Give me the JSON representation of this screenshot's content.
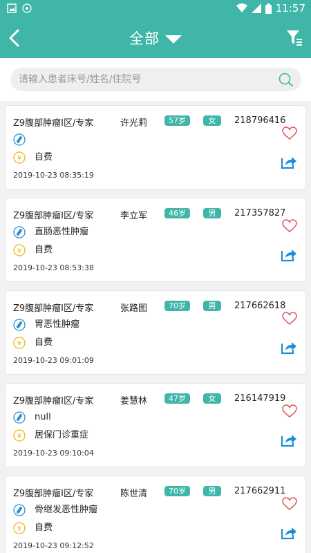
{
  "status_bar": {
    "time": "11:57"
  },
  "header": {
    "title": "全部"
  },
  "search": {
    "placeholder": "请输入患者床号/姓名/住院号"
  },
  "patients": [
    {
      "dept": "Z9腹部肿瘤I区/专家",
      "name": "许光莉",
      "age": "57岁",
      "sex": "女",
      "id": "218796416",
      "diagnosis": "",
      "payment": "自费",
      "time": "2019-10-23 08:35:19"
    },
    {
      "dept": "Z9腹部肿瘤I区/专家",
      "name": "李立军",
      "age": "46岁",
      "sex": "男",
      "id": "217357827",
      "diagnosis": "直肠恶性肿瘤",
      "payment": "自费",
      "time": "2019-10-23 08:53:38"
    },
    {
      "dept": "Z9腹部肿瘤I区/专家",
      "name": "张路图",
      "age": "70岁",
      "sex": "男",
      "id": "217662618",
      "diagnosis": "胃恶性肿瘤",
      "payment": "自费",
      "time": "2019-10-23 09:01:09"
    },
    {
      "dept": "Z9腹部肿瘤I区/专家",
      "name": "姜慧林",
      "age": "47岁",
      "sex": "女",
      "id": "216147919",
      "diagnosis": "null",
      "payment": "居保门诊重症",
      "time": "2019-10-23 09:10:04"
    },
    {
      "dept": "Z9腹部肿瘤I区/专家",
      "name": "陈世清",
      "age": "70岁",
      "sex": "男",
      "id": "217662911",
      "diagnosis": "骨继发恶性肿瘤",
      "payment": "自费",
      "time": "2019-10-23 09:12:52"
    }
  ],
  "colors": {
    "accent": "#3fb6a8",
    "heart": "#e0525a",
    "diagnosis_icon": "#2c8fd4",
    "payment_icon": "#f2b21b",
    "share": "#1a8ed8"
  },
  "icons": {
    "back": "back-icon",
    "filter": "filter-icon",
    "search": "search-icon",
    "heart": "heart-icon",
    "share": "share-icon",
    "diagnosis": "pill-icon",
    "payment": "yen-icon"
  }
}
